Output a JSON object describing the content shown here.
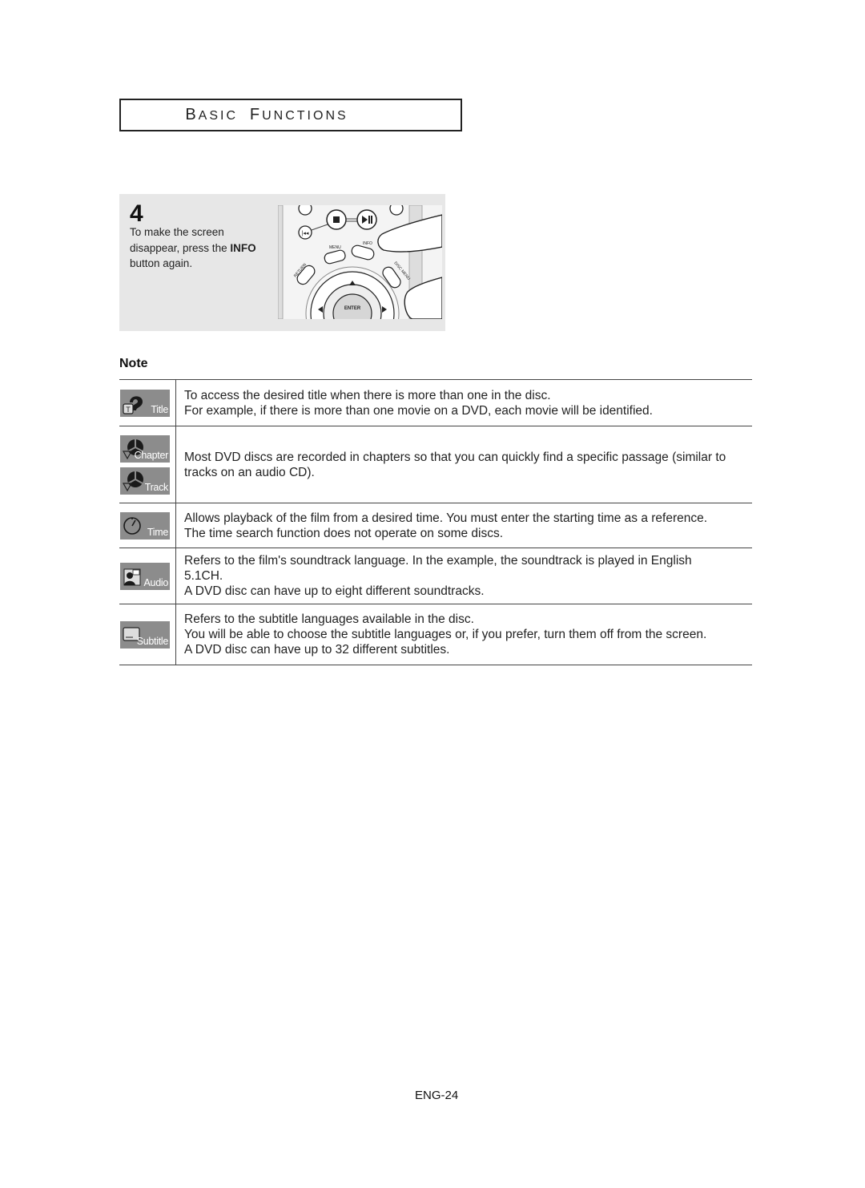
{
  "header": {
    "title_word1_initial": "B",
    "title_word1_rest": "ASIC",
    "title_word2_initial": "F",
    "title_word2_rest": "UNCTIONS"
  },
  "step": {
    "number": "4",
    "text_before": "To make the screen disappear, press the ",
    "text_bold": "INFO",
    "text_after": " button again.",
    "remote_labels": {
      "menu": "MENU",
      "info": "INFO",
      "return": "RETURN",
      "disc_menu": "DISC MENU",
      "enter": "ENTER"
    }
  },
  "note": {
    "label": "Note",
    "rows": [
      {
        "icons": [
          {
            "name": "title-icon",
            "label": "Title"
          }
        ],
        "lines": [
          "To access the desired title when there is more than one in the disc.",
          "For example, if there is more than one movie on a DVD, each movie will be identified."
        ]
      },
      {
        "icons": [
          {
            "name": "chapter-icon",
            "label": "Chapter"
          },
          {
            "name": "track-icon",
            "label": "Track"
          }
        ],
        "lines": [
          "Most DVD discs are recorded in chapters so that you can quickly find a specific passage (similar to tracks on an audio CD)."
        ]
      },
      {
        "icons": [
          {
            "name": "time-icon",
            "label": "Time"
          }
        ],
        "lines": [
          "Allows playback of the film from a desired time. You must enter the starting time as a reference.",
          "The time search function does not operate on some discs."
        ]
      },
      {
        "icons": [
          {
            "name": "audio-icon",
            "label": "Audio"
          }
        ],
        "lines": [
          "Refers to the film's soundtrack language. In the example, the soundtrack is played in English 5.1CH.",
          "A DVD disc can have up to eight different soundtracks."
        ]
      },
      {
        "icons": [
          {
            "name": "subtitle-icon",
            "label": "Subtitle"
          }
        ],
        "lines": [
          "Refers to the subtitle languages available in the disc.",
          "You will be able to choose the subtitle languages or, if you prefer, turn them off from the screen.",
          "A DVD disc can have up to 32 different subtitles."
        ]
      }
    ]
  },
  "footer": {
    "page_number": "ENG-24"
  }
}
